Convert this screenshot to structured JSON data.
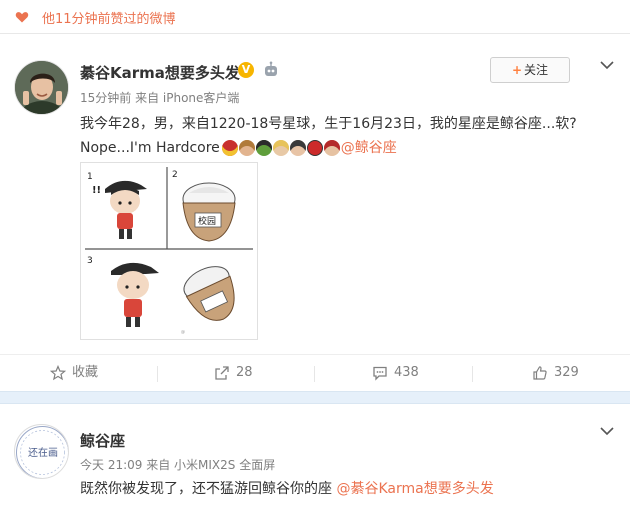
{
  "notice": {
    "text": "他11分钟前赞过的微博",
    "icon": "heart-icon"
  },
  "post1": {
    "username": "綦谷Karma想要多头发",
    "verified_badge": "V",
    "meta": "15分钟前 来自 iPhone客户端",
    "follow_label": "关注",
    "text_line1": "我今年28，男，来自1220-18号星球，生于16月23日，我的星座是鲸谷座...软?",
    "text_line2_prefix": "Nope...I'm Hardcore",
    "mention": "@鲸谷座",
    "emojis": [
      "iron-man-emoji",
      "thor-emoji",
      "hulk-emoji",
      "captain-emoji",
      "black-widow-emoji",
      "spider-man-emoji",
      "nick-fury-emoji"
    ],
    "comic_texts": {
      "panel_numbers": [
        "1",
        "2",
        "3"
      ],
      "bowl_label": "校园"
    },
    "actions": {
      "favorite_label": "收藏",
      "repost_count": "28",
      "comment_count": "438",
      "like_count": "329"
    }
  },
  "post2": {
    "username": "鲸谷座",
    "avatar_text": "还在画",
    "meta": "今天 21:09 来自 小米MIX2S 全面屏",
    "text": "既然你被发现了，还不猛游回鲸谷你的座 ",
    "mention": "@綦谷Karma想要多头发"
  },
  "colors": {
    "accent": "#eb7350",
    "band": "#e6f0fa",
    "badge": "#f7b500"
  }
}
